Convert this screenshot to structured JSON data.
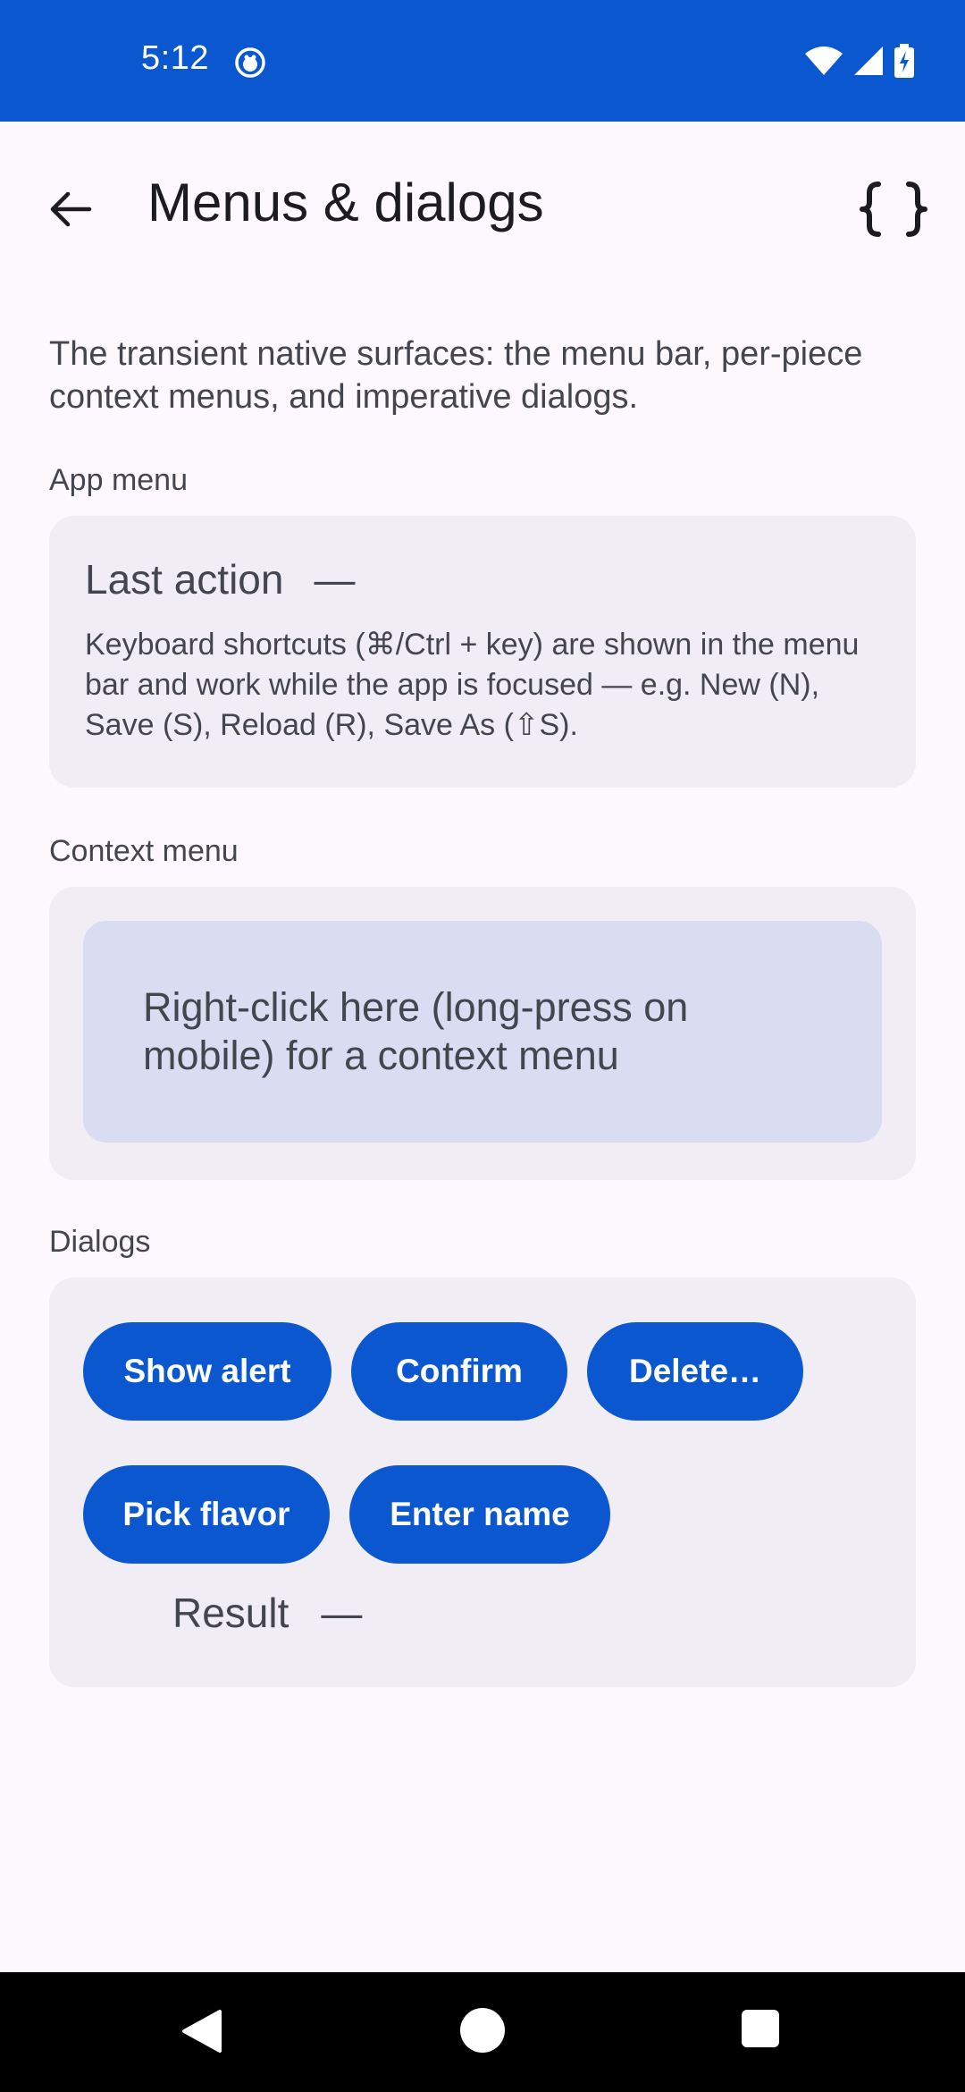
{
  "status_bar": {
    "time": "5:12",
    "icons": [
      "debug-bug-icon",
      "wifi-icon",
      "cellular-signal-icon",
      "battery-charging-icon"
    ],
    "background": "#0b57d0"
  },
  "app_bar": {
    "title": "Menus & dialogs",
    "back_icon": "arrow-back-icon",
    "action_icon": "curly-braces-icon"
  },
  "intro": "The transient native surfaces: the menu bar, per-piece context menus, and imperative dialogs.",
  "app_menu": {
    "section_label": "App menu",
    "last_action_label": "Last action",
    "last_action_value": "—",
    "help_text": "Keyboard shortcuts (⌘/Ctrl + key) are shown in the menu bar and work while the app is focused — e.g. New (N), Save (S), Reload (R), Save As (⇧S)."
  },
  "context_menu": {
    "section_label": "Context menu",
    "target_text": "Right-click here (long-press on mobile) for a context menu"
  },
  "dialogs": {
    "section_label": "Dialogs",
    "buttons": [
      "Show alert",
      "Confirm",
      "Delete…",
      "Pick flavor",
      "Enter name"
    ],
    "result_label": "Result",
    "result_value": "—"
  },
  "colors": {
    "accent": "#0b57d0",
    "card": "#f1edf4",
    "context_target": "#dadcf1",
    "background": "#fdf8fd"
  }
}
